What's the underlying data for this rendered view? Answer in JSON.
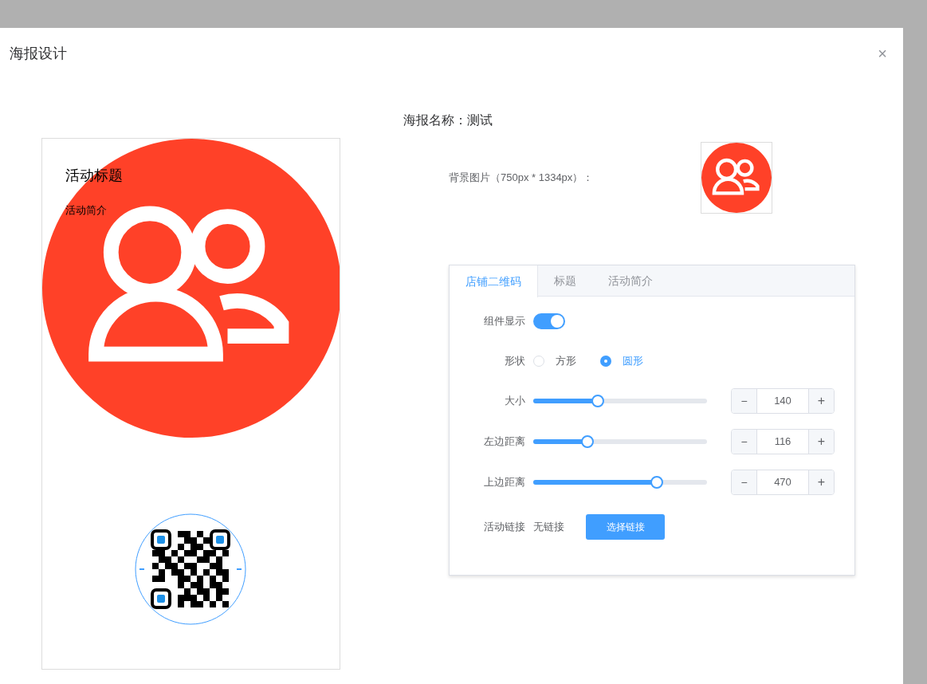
{
  "dialog": {
    "title": "海报设计",
    "close": "×"
  },
  "poster": {
    "title": "活动标题",
    "intro": "活动简介"
  },
  "poster_name": "海报名称：测试",
  "background": {
    "label": "背景图片（750px * 1334px）："
  },
  "tabs": [
    {
      "label": "店铺二维码",
      "selected": true
    },
    {
      "label": "标题",
      "selected": false
    },
    {
      "label": "活动简介",
      "selected": false
    }
  ],
  "form": {
    "display": {
      "label": "组件显示",
      "on": true
    },
    "shape": {
      "label": "形状",
      "options": [
        {
          "label": "方形",
          "selected": false
        },
        {
          "label": "圆形",
          "selected": true
        }
      ]
    },
    "sliders": [
      {
        "label": "大小",
        "level": 0.37,
        "value": "140",
        "minus": "−",
        "plus": "+"
      },
      {
        "label": "左边距离",
        "level": 0.31,
        "value": "116",
        "minus": "−",
        "plus": "+"
      },
      {
        "label": "上边距离",
        "level": 0.71,
        "value": "470",
        "minus": "−",
        "plus": "+"
      }
    ],
    "link": {
      "label": "活动链接",
      "value": "无链接",
      "button": "选择链接"
    }
  }
}
